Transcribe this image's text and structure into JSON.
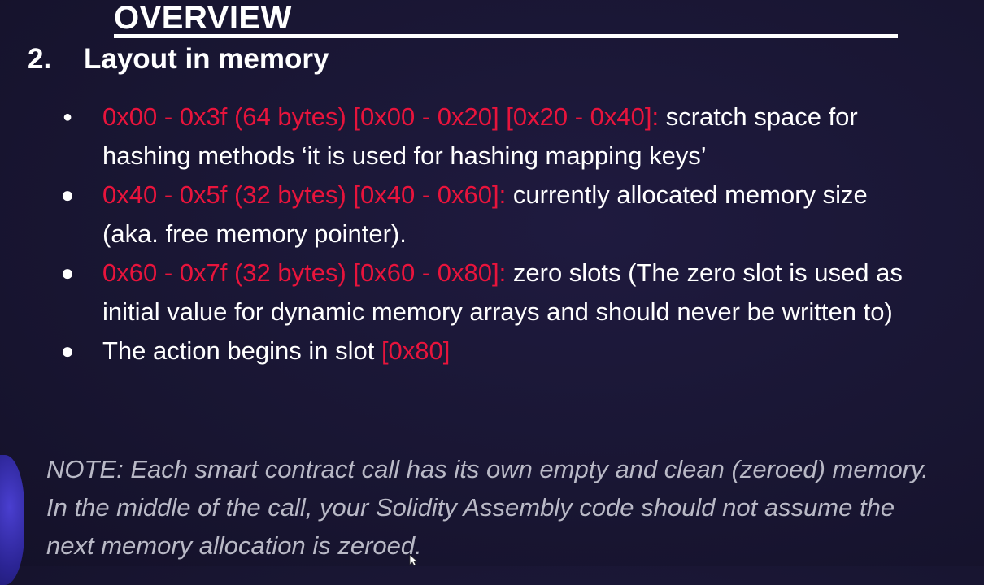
{
  "slide": {
    "title": "OVERVIEW",
    "section_number": "2.",
    "section_title": "Layout in memory"
  },
  "bullets": [
    {
      "highlight": "0x00 - 0x3f (64 bytes) [0x00 - 0x20] [0x20 - 0x40]:",
      "text": " scratch space for hashing methods ‘it is used for hashing mapping keys’"
    },
    {
      "highlight": "0x40 - 0x5f (32 bytes) [0x40 - 0x60]:",
      "text": " currently allocated memory size (aka. free memory pointer)."
    },
    {
      "highlight": "0x60 - 0x7f (32 bytes) [0x60 - 0x80]:",
      "text": " zero slots (The zero slot is used as initial value for dynamic memory arrays and should never be written to)"
    },
    {
      "text": "The action begins in slot ",
      "highlight": "[0x80]"
    }
  ],
  "note": "NOTE: Each smart contract call has its own empty and clean (zeroed) memory. In the middle of the call, your Solidity Assembly code should not assume the next memory allocation is zeroed.",
  "colors": {
    "background": "#191633",
    "text": "#ffffff",
    "highlight": "#e8143c",
    "note": "#b9b9c6",
    "orb": "#2b2494"
  },
  "icons": {
    "bullet": "bullet-dot-icon",
    "cursor": "mouse-pointer-icon"
  }
}
